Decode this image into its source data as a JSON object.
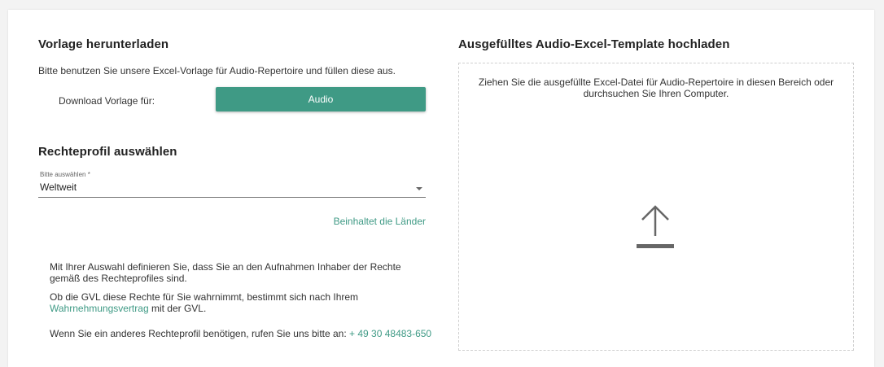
{
  "download": {
    "heading": "Vorlage herunterladen",
    "intro": "Bitte benutzen Sie unsere Excel-Vorlage für Audio-Repertoire und füllen diese aus.",
    "label": "Download Vorlage für:",
    "button_label": "Audio"
  },
  "rights": {
    "heading": "Rechteprofil auswählen",
    "select_label": "Bitte auswählen *",
    "select_value": "Weltweit",
    "countries_link": "Beinhaltet die Länder",
    "info1": "Mit Ihrer Auswahl definieren Sie, dass Sie an den Aufnahmen Inhaber der Rechte gemäß des Rechteprofiles sind.",
    "info2_prefix": "Ob die GVL diese Rechte für Sie wahrnimmt, bestimmt sich nach Ihrem",
    "info2_link": "Wahrnehmungsvertrag",
    "info2_suffix": " mit der GVL.",
    "info3_prefix": "Wenn Sie ein anderes Rechteprofil benötigen, rufen Sie uns bitte an: ",
    "info3_phone": "+ 49 30 48483-650"
  },
  "upload": {
    "heading": "Ausgefülltes Audio-Excel-Template hochladen",
    "drop_text": "Ziehen Sie die ausgefüllte Excel-Datei für Audio-Repertoire in diesen Bereich oder durchsuchen Sie Ihren Computer.",
    "icon": "upload-arrow-icon"
  },
  "colors": {
    "accent": "#3f9a85",
    "text": "#333333",
    "border": "#cfcfcf"
  }
}
